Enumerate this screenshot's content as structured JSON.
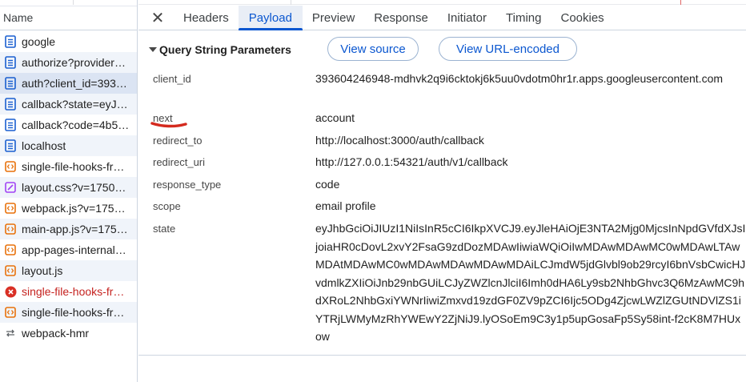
{
  "request_list": {
    "header": "Name",
    "items": [
      {
        "label": "google",
        "icon": "document-icon",
        "status": "normal"
      },
      {
        "label": "authorize?provider…",
        "icon": "document-icon",
        "status": "normal"
      },
      {
        "label": "auth?client_id=393…",
        "icon": "document-icon",
        "status": "selected"
      },
      {
        "label": "callback?state=eyJ…",
        "icon": "document-icon",
        "status": "normal"
      },
      {
        "label": "callback?code=4b5…",
        "icon": "document-icon",
        "status": "normal"
      },
      {
        "label": "localhost",
        "icon": "document-icon",
        "status": "normal"
      },
      {
        "label": "single-file-hooks-fr…",
        "icon": "script-icon",
        "status": "normal"
      },
      {
        "label": "layout.css?v=1750…",
        "icon": "stylesheet-icon",
        "status": "normal"
      },
      {
        "label": "webpack.js?v=175…",
        "icon": "script-icon",
        "status": "normal"
      },
      {
        "label": "main-app.js?v=175…",
        "icon": "script-icon",
        "status": "normal"
      },
      {
        "label": "app-pages-internal…",
        "icon": "script-icon",
        "status": "normal"
      },
      {
        "label": "layout.js",
        "icon": "script-icon",
        "status": "normal"
      },
      {
        "label": "single-file-hooks-fr…",
        "icon": "error-icon",
        "status": "error"
      },
      {
        "label": "single-file-hooks-fr…",
        "icon": "script-icon",
        "status": "normal"
      },
      {
        "label": "webpack-hmr",
        "icon": "websocket-icon",
        "status": "normal"
      }
    ]
  },
  "detail": {
    "close_icon": "close-icon",
    "tabs": [
      "Headers",
      "Payload",
      "Preview",
      "Response",
      "Initiator",
      "Timing",
      "Cookies"
    ],
    "active_tab": "Payload",
    "section_title": "Query String Parameters",
    "view_source_label": "View source",
    "view_url_encoded_label": "View URL-encoded",
    "params": [
      {
        "key": "client_id",
        "value": "393604246948-mdhvk2q9i6cktokj6k5uu0vdotm0hr1r.apps.googleusercontent.com"
      },
      {
        "key": "next",
        "value": "account"
      },
      {
        "key": "redirect_to",
        "value": "http://localhost:3000/auth/callback"
      },
      {
        "key": "redirect_uri",
        "value": "http://127.0.0.1:54321/auth/v1/callback"
      },
      {
        "key": "response_type",
        "value": "code"
      },
      {
        "key": "scope",
        "value": "email profile"
      },
      {
        "key": "state",
        "value": "eyJhbGciOiJIUzI1NiIsInR5cCI6IkpXVCJ9.eyJleHAiOjE3NTA2Mjg0MjcsInNpdGVfdXJsIjoiaHR0cDovL2xvY2FsaG9zdDozMDAwIiwiaWQiOiIwMDAwMDAwMC0wMDAwLTAwMDAtMDAwMC0wMDAwMDAwMDAwMDAiLCJmdW5jdGlvbl9ob29rcyI6bnVsbCwicHJvdmlkZXIiOiJnb29nbGUiLCJyZWZlcnJlciI6Imh0dHA6Ly9sb2NhbGhvc3Q6MzAwMC9hdXRoL2NhbGxiYWNrIiwiZmxvd19zdGF0ZV9pZCI6Ijc5ODg4ZjcwLWZlZGUtNDVlZS1iYTRjLWMyMzRhYWEwY2ZjNiJ9.lyOSoEm9C3y1p5upGosaFp5Sy58int-f2cK8M7HUxow"
      }
    ],
    "annotation_color": "#d42a1e"
  },
  "colors": {
    "accent": "#0b57d0",
    "selected_row": "#dbe4f3",
    "error_text": "#c5221f",
    "border": "#cdd5e0"
  }
}
